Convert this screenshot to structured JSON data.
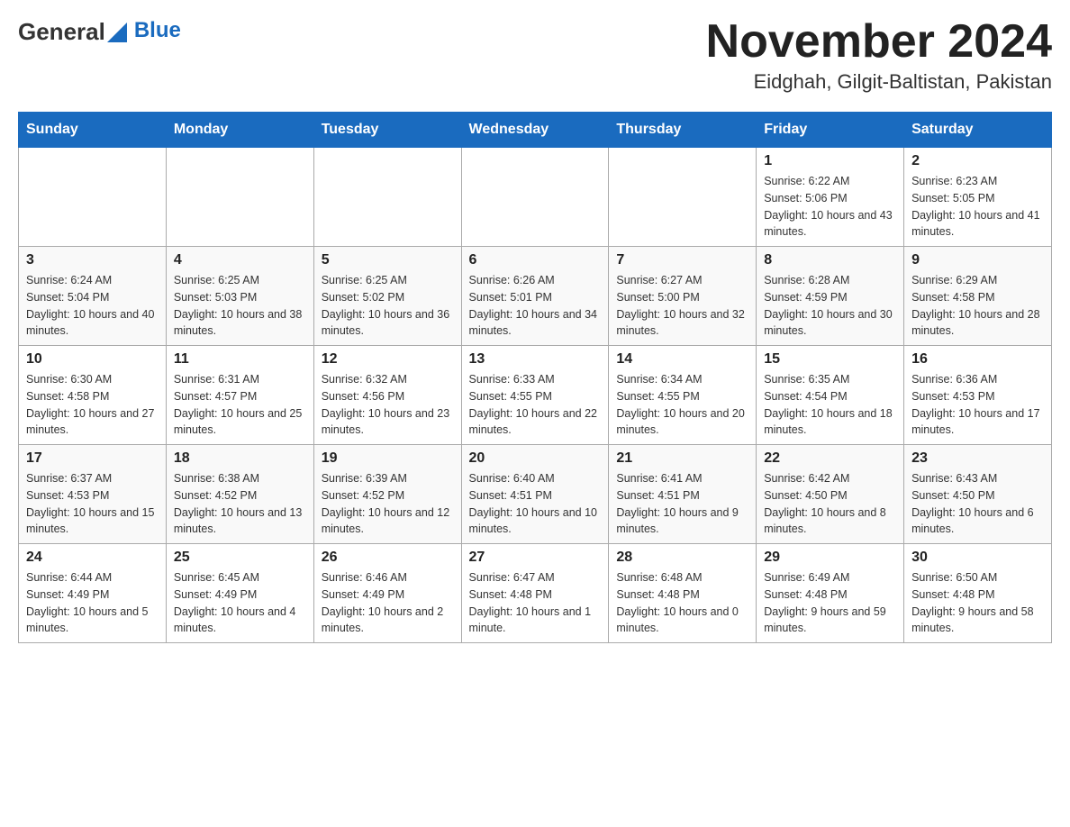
{
  "header": {
    "logo": {
      "text_general": "General",
      "text_blue": "Blue"
    },
    "title": "November 2024",
    "location": "Eidghah, Gilgit-Baltistan, Pakistan"
  },
  "weekdays": [
    "Sunday",
    "Monday",
    "Tuesday",
    "Wednesday",
    "Thursday",
    "Friday",
    "Saturday"
  ],
  "weeks": [
    {
      "days": [
        {
          "number": "",
          "info": ""
        },
        {
          "number": "",
          "info": ""
        },
        {
          "number": "",
          "info": ""
        },
        {
          "number": "",
          "info": ""
        },
        {
          "number": "",
          "info": ""
        },
        {
          "number": "1",
          "info": "Sunrise: 6:22 AM\nSunset: 5:06 PM\nDaylight: 10 hours and 43 minutes."
        },
        {
          "number": "2",
          "info": "Sunrise: 6:23 AM\nSunset: 5:05 PM\nDaylight: 10 hours and 41 minutes."
        }
      ]
    },
    {
      "days": [
        {
          "number": "3",
          "info": "Sunrise: 6:24 AM\nSunset: 5:04 PM\nDaylight: 10 hours and 40 minutes."
        },
        {
          "number": "4",
          "info": "Sunrise: 6:25 AM\nSunset: 5:03 PM\nDaylight: 10 hours and 38 minutes."
        },
        {
          "number": "5",
          "info": "Sunrise: 6:25 AM\nSunset: 5:02 PM\nDaylight: 10 hours and 36 minutes."
        },
        {
          "number": "6",
          "info": "Sunrise: 6:26 AM\nSunset: 5:01 PM\nDaylight: 10 hours and 34 minutes."
        },
        {
          "number": "7",
          "info": "Sunrise: 6:27 AM\nSunset: 5:00 PM\nDaylight: 10 hours and 32 minutes."
        },
        {
          "number": "8",
          "info": "Sunrise: 6:28 AM\nSunset: 4:59 PM\nDaylight: 10 hours and 30 minutes."
        },
        {
          "number": "9",
          "info": "Sunrise: 6:29 AM\nSunset: 4:58 PM\nDaylight: 10 hours and 28 minutes."
        }
      ]
    },
    {
      "days": [
        {
          "number": "10",
          "info": "Sunrise: 6:30 AM\nSunset: 4:58 PM\nDaylight: 10 hours and 27 minutes."
        },
        {
          "number": "11",
          "info": "Sunrise: 6:31 AM\nSunset: 4:57 PM\nDaylight: 10 hours and 25 minutes."
        },
        {
          "number": "12",
          "info": "Sunrise: 6:32 AM\nSunset: 4:56 PM\nDaylight: 10 hours and 23 minutes."
        },
        {
          "number": "13",
          "info": "Sunrise: 6:33 AM\nSunset: 4:55 PM\nDaylight: 10 hours and 22 minutes."
        },
        {
          "number": "14",
          "info": "Sunrise: 6:34 AM\nSunset: 4:55 PM\nDaylight: 10 hours and 20 minutes."
        },
        {
          "number": "15",
          "info": "Sunrise: 6:35 AM\nSunset: 4:54 PM\nDaylight: 10 hours and 18 minutes."
        },
        {
          "number": "16",
          "info": "Sunrise: 6:36 AM\nSunset: 4:53 PM\nDaylight: 10 hours and 17 minutes."
        }
      ]
    },
    {
      "days": [
        {
          "number": "17",
          "info": "Sunrise: 6:37 AM\nSunset: 4:53 PM\nDaylight: 10 hours and 15 minutes."
        },
        {
          "number": "18",
          "info": "Sunrise: 6:38 AM\nSunset: 4:52 PM\nDaylight: 10 hours and 13 minutes."
        },
        {
          "number": "19",
          "info": "Sunrise: 6:39 AM\nSunset: 4:52 PM\nDaylight: 10 hours and 12 minutes."
        },
        {
          "number": "20",
          "info": "Sunrise: 6:40 AM\nSunset: 4:51 PM\nDaylight: 10 hours and 10 minutes."
        },
        {
          "number": "21",
          "info": "Sunrise: 6:41 AM\nSunset: 4:51 PM\nDaylight: 10 hours and 9 minutes."
        },
        {
          "number": "22",
          "info": "Sunrise: 6:42 AM\nSunset: 4:50 PM\nDaylight: 10 hours and 8 minutes."
        },
        {
          "number": "23",
          "info": "Sunrise: 6:43 AM\nSunset: 4:50 PM\nDaylight: 10 hours and 6 minutes."
        }
      ]
    },
    {
      "days": [
        {
          "number": "24",
          "info": "Sunrise: 6:44 AM\nSunset: 4:49 PM\nDaylight: 10 hours and 5 minutes."
        },
        {
          "number": "25",
          "info": "Sunrise: 6:45 AM\nSunset: 4:49 PM\nDaylight: 10 hours and 4 minutes."
        },
        {
          "number": "26",
          "info": "Sunrise: 6:46 AM\nSunset: 4:49 PM\nDaylight: 10 hours and 2 minutes."
        },
        {
          "number": "27",
          "info": "Sunrise: 6:47 AM\nSunset: 4:48 PM\nDaylight: 10 hours and 1 minute."
        },
        {
          "number": "28",
          "info": "Sunrise: 6:48 AM\nSunset: 4:48 PM\nDaylight: 10 hours and 0 minutes."
        },
        {
          "number": "29",
          "info": "Sunrise: 6:49 AM\nSunset: 4:48 PM\nDaylight: 9 hours and 59 minutes."
        },
        {
          "number": "30",
          "info": "Sunrise: 6:50 AM\nSunset: 4:48 PM\nDaylight: 9 hours and 58 minutes."
        }
      ]
    }
  ]
}
